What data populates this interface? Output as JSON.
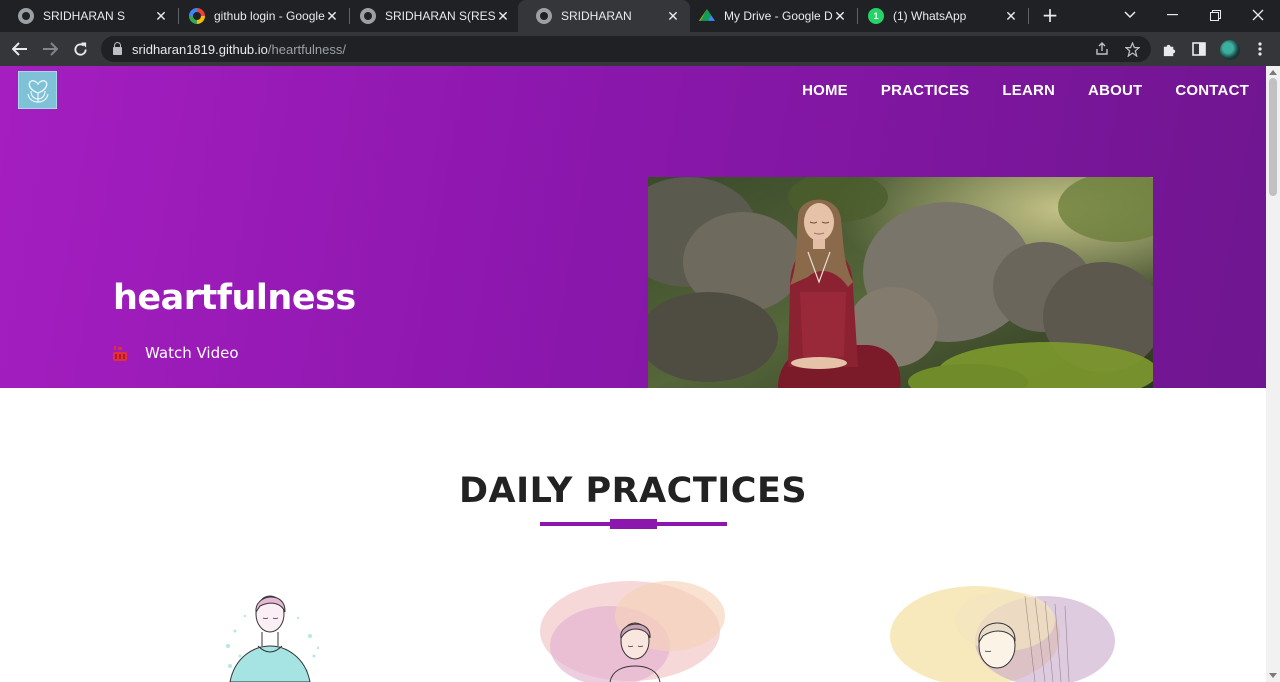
{
  "browser": {
    "tabs": [
      {
        "title": "SRIDHARAN S",
        "icon": "globe-icon",
        "active": false
      },
      {
        "title": "github login - Google",
        "icon": "google-icon",
        "active": false
      },
      {
        "title": "SRIDHARAN S(RESUM",
        "icon": "globe-icon",
        "active": false
      },
      {
        "title": "SRIDHARAN",
        "icon": "globe-icon",
        "active": true
      },
      {
        "title": "My Drive - Google Dr",
        "icon": "google-drive-icon",
        "active": false
      },
      {
        "title": "(1) WhatsApp",
        "icon": "whatsapp-icon",
        "active": false
      }
    ],
    "whatsapp_badge": "1",
    "url_host": "sridharan1819.github.io",
    "url_path": "/heartfulness/"
  },
  "site": {
    "nav": [
      "HOME",
      "PRACTICES",
      "LEARN",
      "ABOUT",
      "CONTACT"
    ],
    "hero_title": "heartfulness",
    "watch_video": "Watch Video",
    "section_title": "DAILY PRACTICES"
  },
  "colors": {
    "hero_start": "#a51ec0",
    "hero_end": "#6f168f",
    "accent": "#8b17ad"
  }
}
